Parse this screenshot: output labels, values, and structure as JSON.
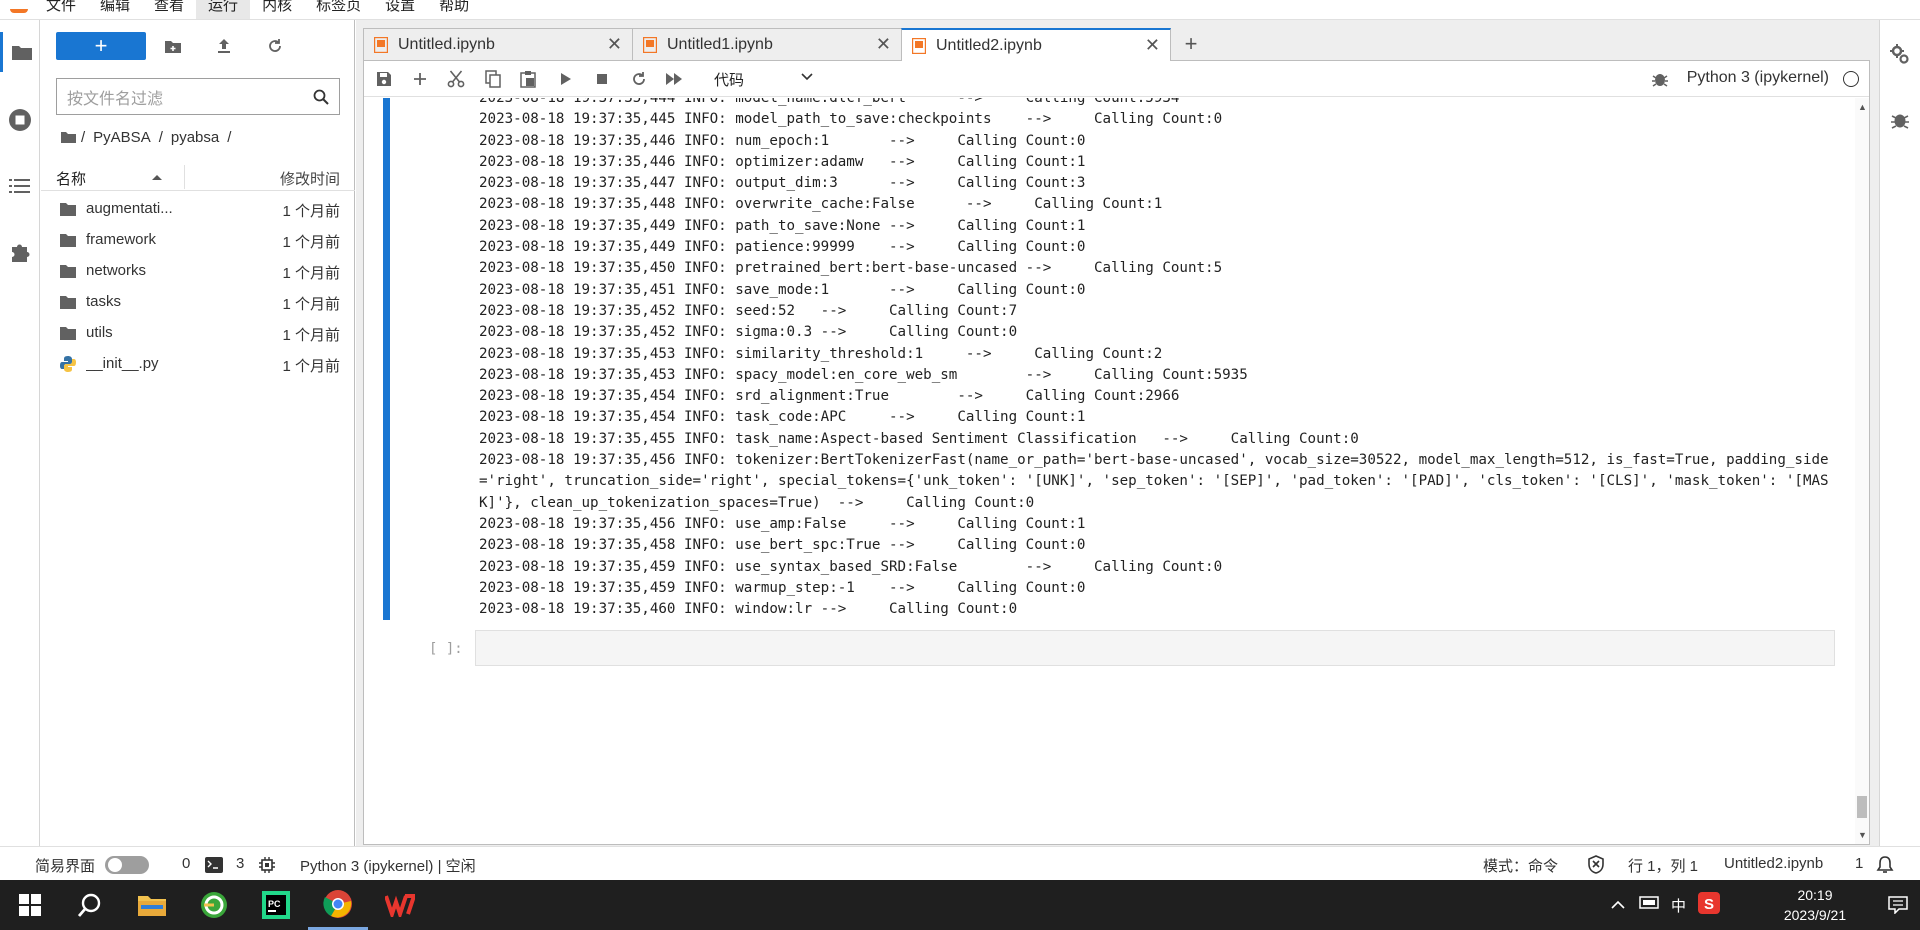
{
  "menubar": {
    "items": [
      "文件",
      "编辑",
      "查看",
      "运行",
      "内核",
      "标签页",
      "设置",
      "帮助"
    ]
  },
  "filebrowser": {
    "new_label": "+",
    "filter_placeholder": "按文件名过滤",
    "breadcrumb": [
      "/",
      "PyABSA",
      "/",
      "pyabsa",
      "/"
    ],
    "col_name": "名称",
    "col_modified": "修改时间",
    "files": [
      {
        "name": "augmentati...",
        "modified": "1 个月前",
        "type": "folder"
      },
      {
        "name": "framework",
        "modified": "1 个月前",
        "type": "folder"
      },
      {
        "name": "networks",
        "modified": "1 个月前",
        "type": "folder"
      },
      {
        "name": "tasks",
        "modified": "1 个月前",
        "type": "folder"
      },
      {
        "name": "utils",
        "modified": "1 个月前",
        "type": "folder"
      },
      {
        "name": "__init__.py",
        "modified": "1 个月前",
        "type": "python"
      }
    ]
  },
  "tabs": [
    {
      "label": "Untitled.ipynb",
      "active": false
    },
    {
      "label": "Untitled1.ipynb",
      "active": false
    },
    {
      "label": "Untitled2.ipynb",
      "active": true
    }
  ],
  "notebook": {
    "cell_type": "代码",
    "kernel": "Python 3 (ipykernel)",
    "prompt": "[ ]:",
    "output_lines": [
      "2023-08-18 19:37:35,444 INFO: model_name:dlcf_bert      -->     Calling Count:5934",
      "2023-08-18 19:37:35,445 INFO: model_path_to_save:checkpoints    -->     Calling Count:0",
      "2023-08-18 19:37:35,446 INFO: num_epoch:1       -->     Calling Count:0",
      "2023-08-18 19:37:35,446 INFO: optimizer:adamw   -->     Calling Count:1",
      "2023-08-18 19:37:35,447 INFO: output_dim:3      -->     Calling Count:3",
      "2023-08-18 19:37:35,448 INFO: overwrite_cache:False      -->     Calling Count:1",
      "2023-08-18 19:37:35,449 INFO: path_to_save:None -->     Calling Count:1",
      "2023-08-18 19:37:35,449 INFO: patience:99999    -->     Calling Count:0",
      "2023-08-18 19:37:35,450 INFO: pretrained_bert:bert-base-uncased -->     Calling Count:5",
      "2023-08-18 19:37:35,451 INFO: save_mode:1       -->     Calling Count:0",
      "2023-08-18 19:37:35,452 INFO: seed:52   -->     Calling Count:7",
      "2023-08-18 19:37:35,452 INFO: sigma:0.3 -->     Calling Count:0",
      "2023-08-18 19:37:35,453 INFO: similarity_threshold:1     -->     Calling Count:2",
      "2023-08-18 19:37:35,453 INFO: spacy_model:en_core_web_sm        -->     Calling Count:5935",
      "2023-08-18 19:37:35,454 INFO: srd_alignment:True        -->     Calling Count:2966",
      "2023-08-18 19:37:35,454 INFO: task_code:APC     -->     Calling Count:1",
      "2023-08-18 19:37:35,455 INFO: task_name:Aspect-based Sentiment Classification   -->     Calling Count:0",
      "2023-08-18 19:37:35,456 INFO: tokenizer:BertTokenizerFast(name_or_path='bert-base-uncased', vocab_size=30522, model_max_length=512, is_fast=True, padding_side='right', truncation_side='right', special_tokens={'unk_token': '[UNK]', 'sep_token': '[SEP]', 'pad_token': '[PAD]', 'cls_token': '[CLS]', 'mask_token': '[MASK]'}, clean_up_tokenization_spaces=True)  -->     Calling Count:0",
      "2023-08-18 19:37:35,456 INFO: use_amp:False     -->     Calling Count:1",
      "2023-08-18 19:37:35,458 INFO: use_bert_spc:True -->     Calling Count:0",
      "2023-08-18 19:37:35,459 INFO: use_syntax_based_SRD:False        -->     Calling Count:0",
      "2023-08-18 19:37:35,459 INFO: warmup_step:-1    -->     Calling Count:0",
      "2023-08-18 19:37:35,460 INFO: window:lr -->     Calling Count:0"
    ]
  },
  "statusbar": {
    "simple_mode": "简易界面",
    "count1": "0",
    "count2": "3",
    "kernel_status": "Python 3 (ipykernel) | 空闲",
    "mode": "模式：命令",
    "position": "行 1，列 1",
    "filename": "Untitled2.ipynb",
    "notifications": "1"
  },
  "taskbar": {
    "time": "20:19",
    "date": "2023/9/21",
    "ime": "中"
  },
  "colors": {
    "accent": "#1976d2",
    "notebook_orange": "#f37726",
    "taskbar": "#1f1f1f"
  }
}
